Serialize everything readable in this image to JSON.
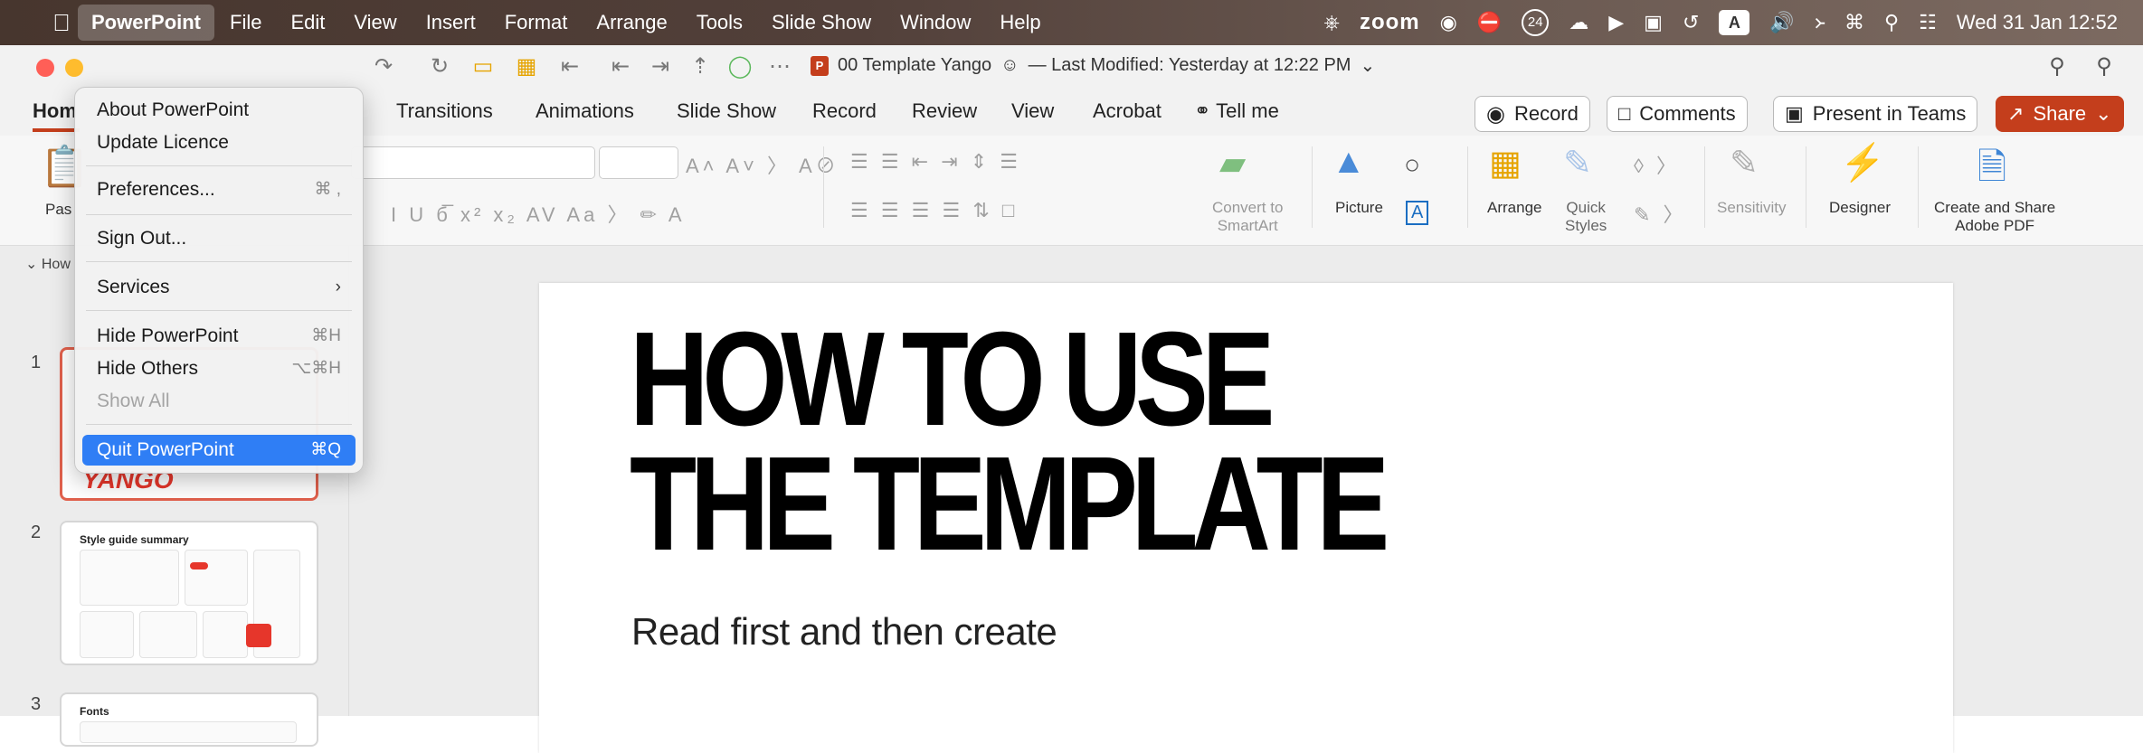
{
  "menubar": {
    "app": "PowerPoint",
    "items": [
      "File",
      "Edit",
      "View",
      "Insert",
      "Format",
      "Arrange",
      "Tools",
      "Slide Show",
      "Window",
      "Help"
    ],
    "zoom": "zoom",
    "input_source": "A",
    "badge": "24",
    "clock": "Wed 31 Jan 12:52"
  },
  "document": {
    "title": "00 Template Yango",
    "modified": "— Last Modified: Yesterday at 12:22 PM"
  },
  "ribbon_tabs": [
    "Hom",
    "Transitions",
    "Animations",
    "Slide Show",
    "Record",
    "Review",
    "View",
    "Acrobat"
  ],
  "tell_me": "Tell me",
  "actions": {
    "record": "Record",
    "comments": "Comments",
    "present": "Present in Teams",
    "share": "Share"
  },
  "ribbon": {
    "paste": "Pas",
    "convert_smartart": [
      "Convert to",
      "SmartArt"
    ],
    "picture": "Picture",
    "arrange": "Arrange",
    "quick_styles": [
      "Quick",
      "Styles"
    ],
    "sensitivity": "Sensitivity",
    "designer": "Designer",
    "create_share": [
      "Create and Share",
      "Adobe PDF"
    ]
  },
  "app_menu": {
    "about": "About PowerPoint",
    "update": "Update Licence",
    "preferences": "Preferences...",
    "preferences_sc": "⌘ ,",
    "sign_out": "Sign Out...",
    "services": "Services",
    "hide": "Hide PowerPoint",
    "hide_sc": "⌘H",
    "hide_others": "Hide Others",
    "hide_others_sc": "⌥⌘H",
    "show_all": "Show All",
    "quit": "Quit PowerPoint",
    "quit_sc": "⌘Q"
  },
  "sidebar": {
    "section": "How",
    "slides": [
      {
        "num": "1",
        "text": "YANGO"
      },
      {
        "num": "2",
        "title": "Style guide summary"
      },
      {
        "num": "3",
        "title": "Fonts"
      }
    ]
  },
  "slide": {
    "title_line1": "HOW TO USE",
    "title_line2": "THE TEMPLATE",
    "subtitle": "Read first and then create"
  },
  "colors": {
    "accent": "#c43e1c",
    "highlight": "#2f7ef5"
  }
}
